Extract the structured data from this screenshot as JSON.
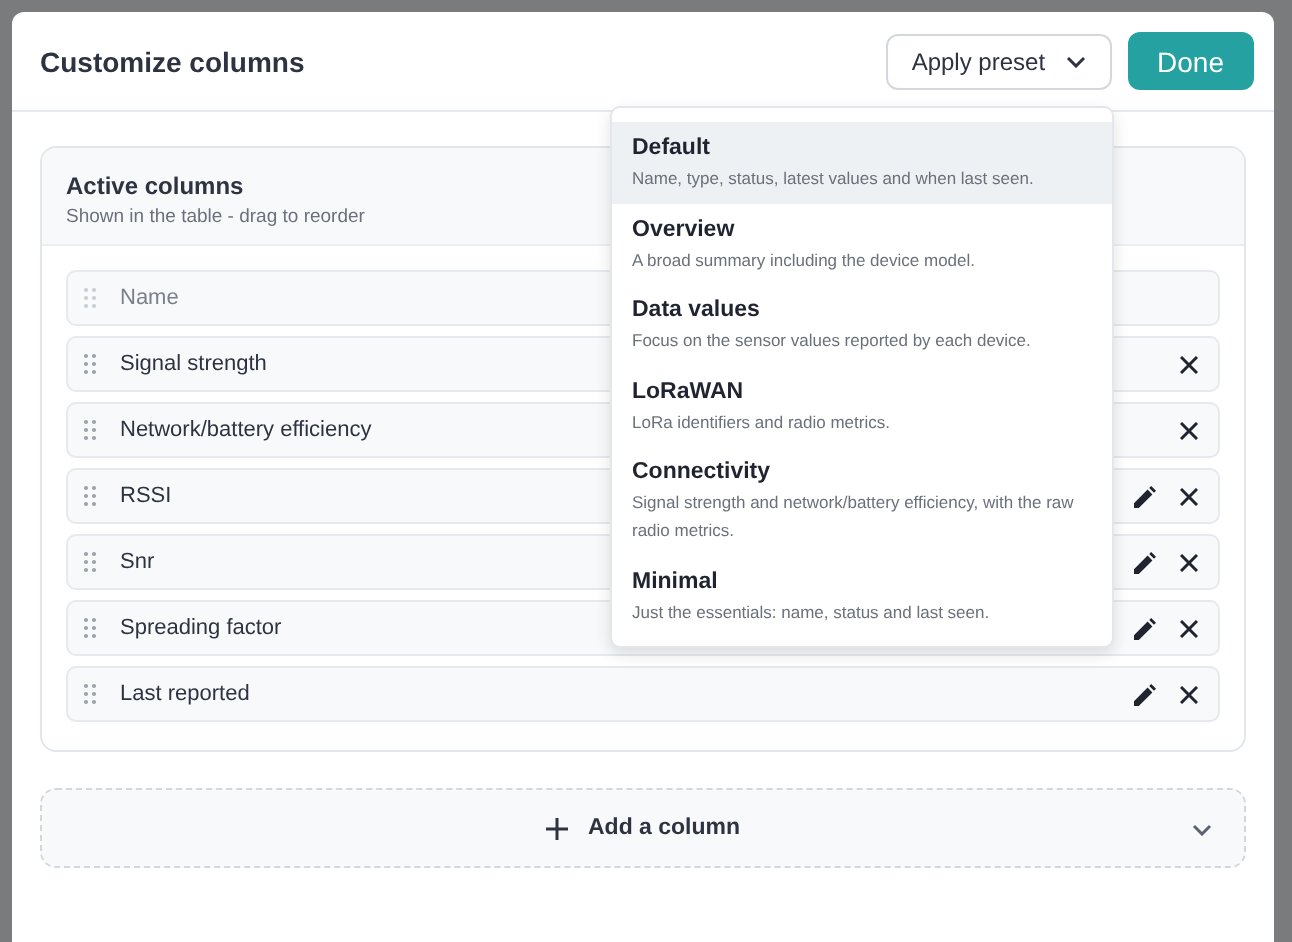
{
  "dialog": {
    "title": "Customize columns",
    "preset_button": "Apply preset",
    "done_button": "Done"
  },
  "active_columns": {
    "title": "Active columns",
    "subtitle": "Shown in the table - drag to reorder",
    "rows": [
      {
        "label": "Name",
        "disabled": true,
        "removable": false,
        "editable": false
      },
      {
        "label": "Signal strength",
        "disabled": false,
        "removable": true,
        "editable": false
      },
      {
        "label": "Network/battery efficiency",
        "disabled": false,
        "removable": true,
        "editable": false
      },
      {
        "label": "RSSI",
        "disabled": false,
        "removable": true,
        "editable": true
      },
      {
        "label": "Snr",
        "disabled": false,
        "removable": true,
        "editable": true
      },
      {
        "label": "Spreading factor",
        "disabled": false,
        "removable": true,
        "editable": true
      },
      {
        "label": "Last reported",
        "disabled": false,
        "removable": true,
        "editable": true
      }
    ]
  },
  "preset_menu": {
    "expanded": true,
    "items": [
      {
        "title": "Default",
        "description": "Name, type, status, latest values and when last seen.",
        "selected": true
      },
      {
        "title": "Overview",
        "description": "A broad summary including the device model.",
        "selected": false
      },
      {
        "title": "Data values",
        "description": "Focus on the sensor values reported by each device.",
        "selected": false
      },
      {
        "title": "LoRaWAN",
        "description": "LoRa identifiers and radio metrics.",
        "selected": false
      },
      {
        "title": "Connectivity",
        "description": "Signal strength and network/battery efficiency, with the raw radio metrics.",
        "selected": false
      },
      {
        "title": "Minimal",
        "description": "Just the essentials: name, status and last seen.",
        "selected": false
      }
    ]
  },
  "add_column": {
    "label": "Add a column"
  }
}
